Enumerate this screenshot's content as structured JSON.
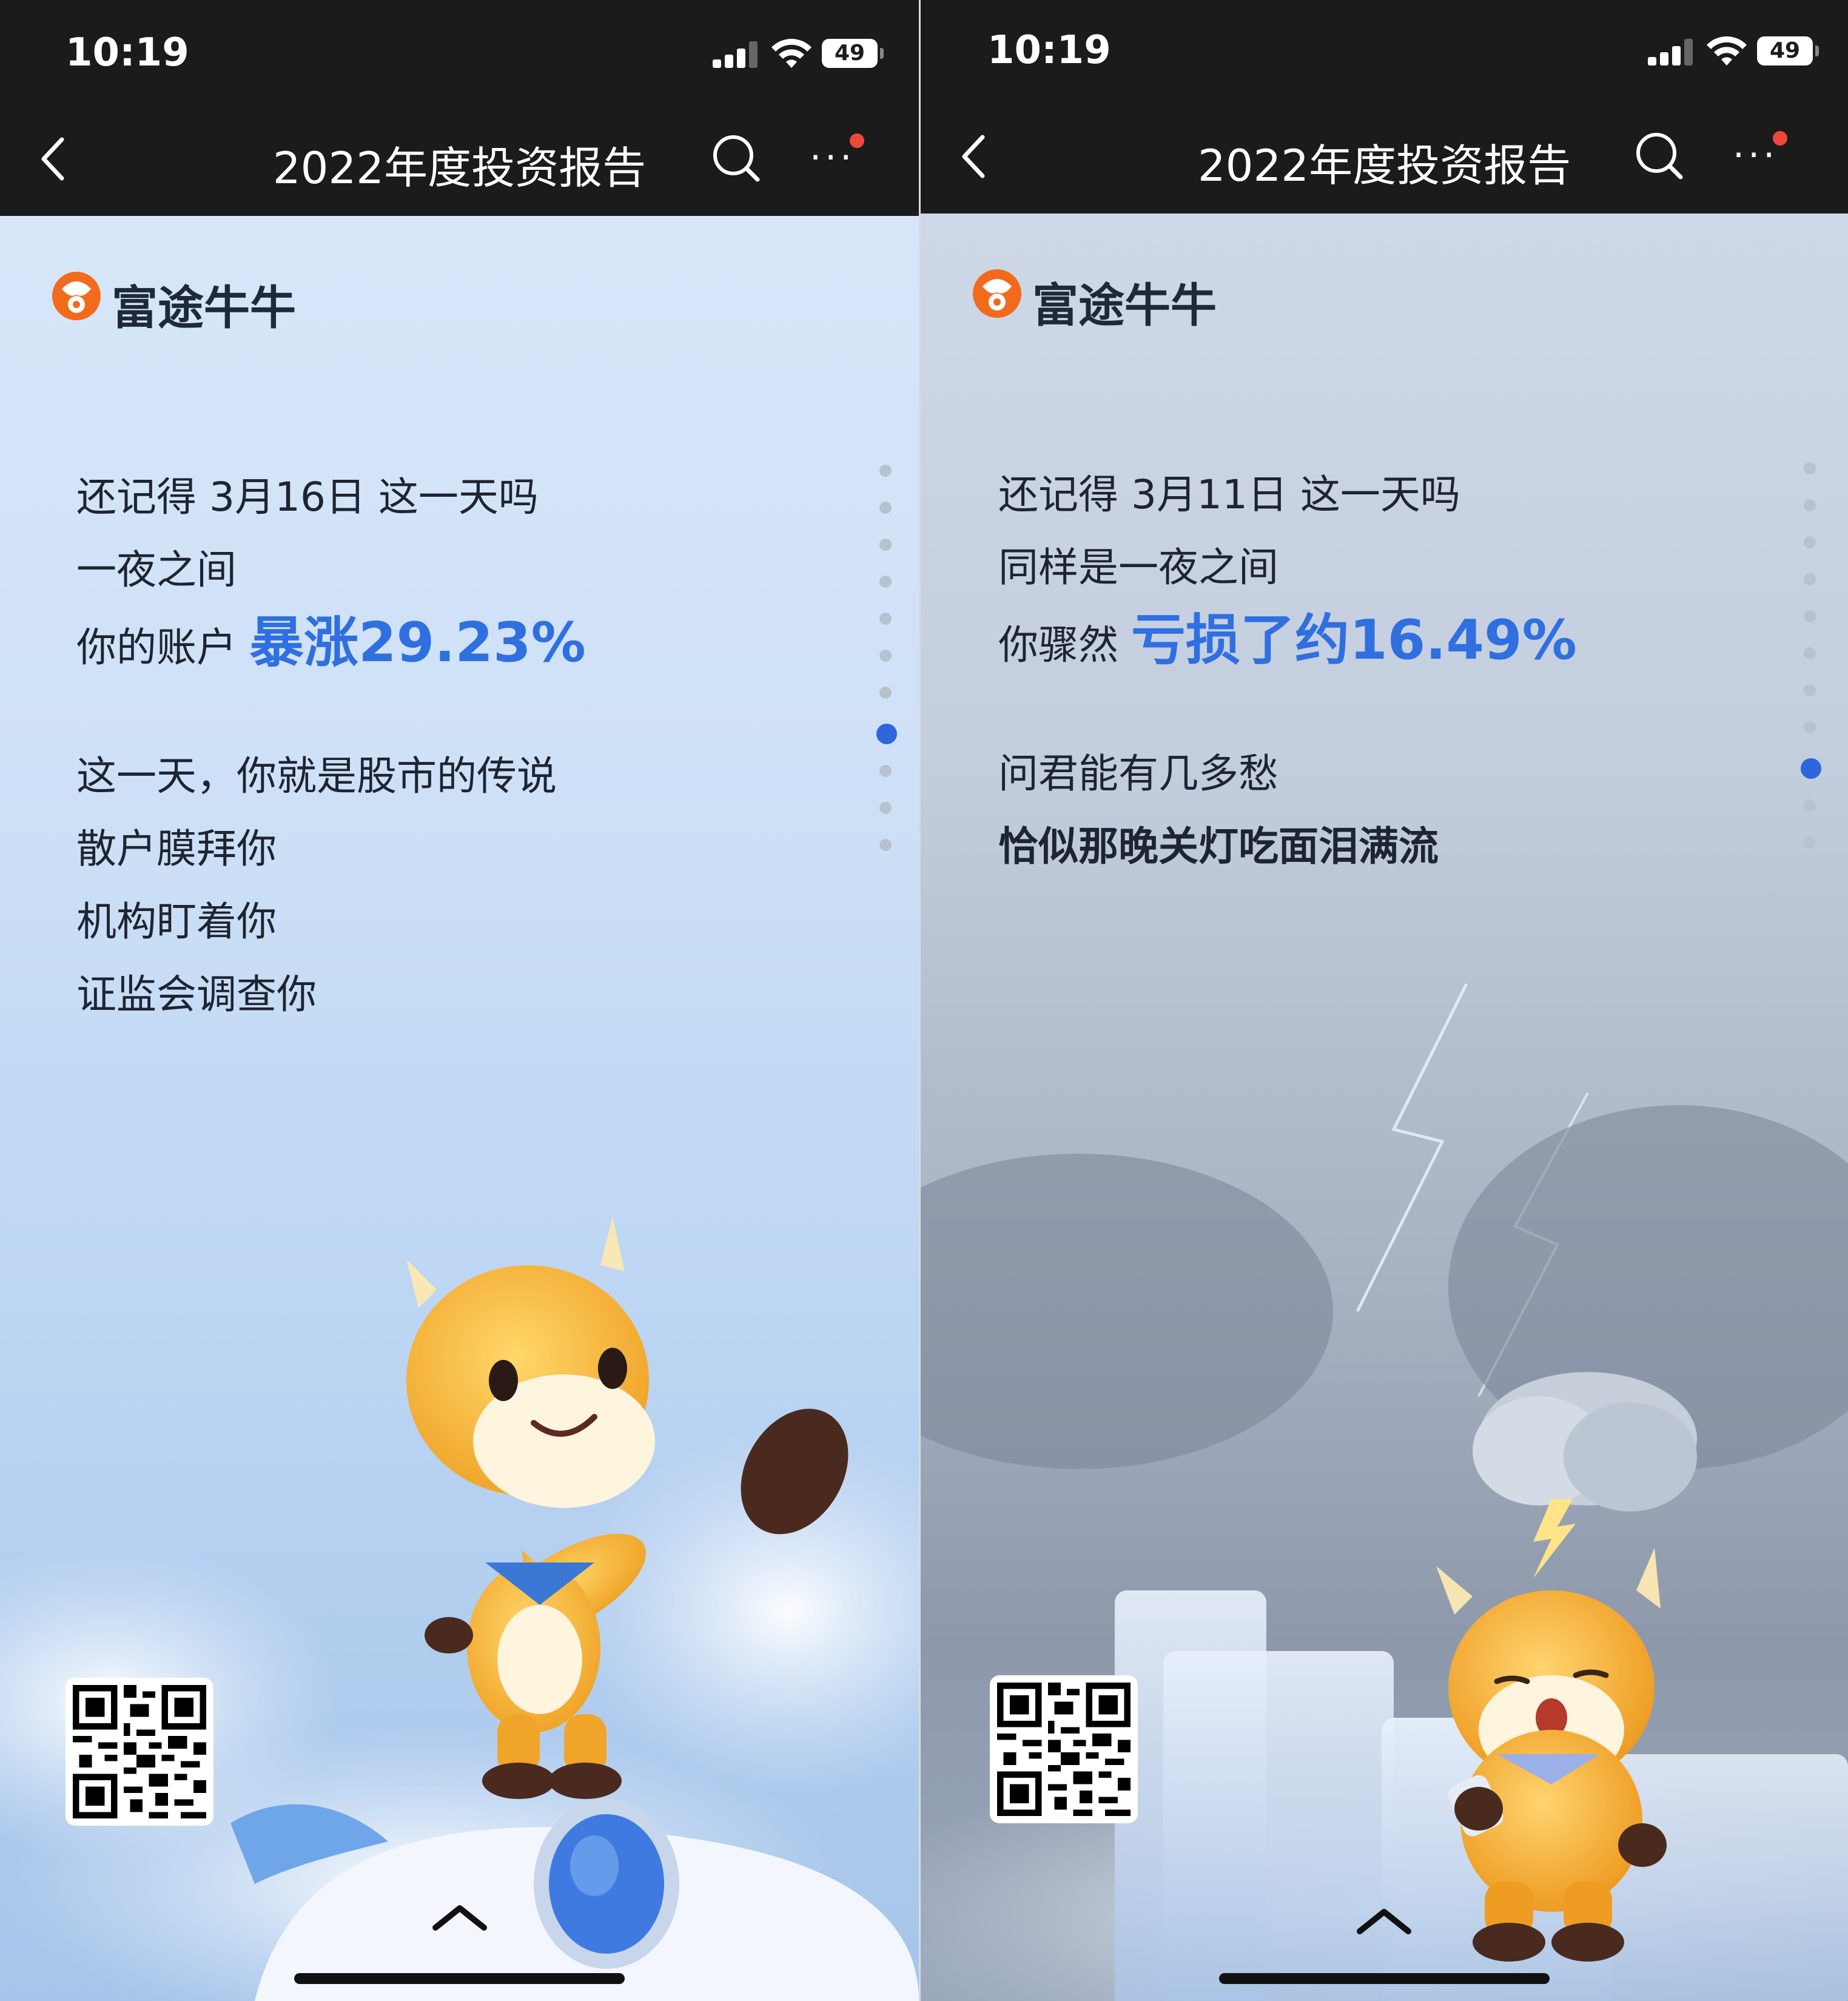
{
  "left": {
    "status": {
      "time": "10:19",
      "battery": "49"
    },
    "nav": {
      "title": "2022年度投资报告"
    },
    "logo": {
      "text": "富途牛牛"
    },
    "lines": {
      "l1": "还记得 3月16日 这一天吗",
      "l2": "一夜之间",
      "l3_prefix": "你的账户 ",
      "l3_highlight": "暴涨29.23%",
      "l4": "这一天，你就是股市的传说",
      "l5": "散户膜拜你",
      "l6": "机构盯着你",
      "l7": "证监会调查你"
    },
    "pager": {
      "total": 11,
      "active": 7
    }
  },
  "right": {
    "status": {
      "time": "10:19",
      "battery": "49"
    },
    "nav": {
      "title": "2022年度投资报告"
    },
    "logo": {
      "text": "富途牛牛"
    },
    "lines": {
      "l1": "还记得 3月11日 这一天吗",
      "l2": "同样是一夜之间",
      "l3_prefix": "你骤然 ",
      "l3_highlight": "亏损了约16.49%",
      "l4": "问君能有几多愁",
      "l5": "恰似那晚关灯吃面泪满流"
    },
    "pager": {
      "total": 11,
      "active": 8
    }
  },
  "colors": {
    "highlight": "#2f6fe0",
    "navbar": "#1b1b1c",
    "badge": "#f0473c",
    "brand": "#f26b1d"
  },
  "icons": [
    "back-icon",
    "search-icon",
    "more-icon",
    "signal-icon",
    "wifi-icon",
    "battery-icon",
    "futu-logo-icon",
    "qr-code",
    "chevron-up-icon"
  ]
}
